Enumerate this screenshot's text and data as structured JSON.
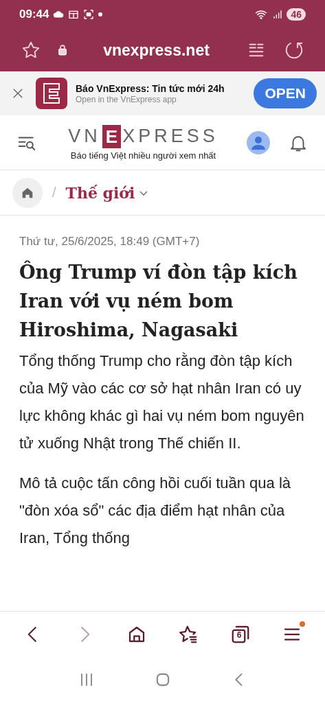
{
  "status_bar": {
    "time": "09:44",
    "battery": "46"
  },
  "browser_bar": {
    "url": "vnexpress.net"
  },
  "app_banner": {
    "title": "Báo VnExpress: Tin tức mới 24h",
    "subtitle": "Open in the VnExpress app",
    "button": "OPEN"
  },
  "site_header": {
    "logo_left": "VN",
    "logo_mark": "E",
    "logo_right": "XPRESS",
    "tagline": "Báo tiếng Việt nhiều người xem nhất"
  },
  "breadcrumb": {
    "separator": "/",
    "section": "Thế giới"
  },
  "article": {
    "date": "Thứ tư, 25/6/2025, 18:49 (GMT+7)",
    "title": "Ông Trump ví đòn tập kích Iran với vụ ném bom Hiroshima, Nagasaki",
    "lead": "Tổng thống Trump cho rằng đòn tập kích của Mỹ vào các cơ sở hạt nhân Iran có uy lực không khác gì hai vụ ném bom nguyên tử xuống Nhật trong Thế chiến II.",
    "paragraphs": [
      "Mô tả cuộc tấn công hồi cuối tuần qua là \"đòn xóa sổ\" các địa điểm hạt nhân của Iran, Tổng thống"
    ]
  },
  "toolbar": {
    "back_disabled": false,
    "forward_disabled": true,
    "tab_count": "6",
    "menu_notification": true
  }
}
